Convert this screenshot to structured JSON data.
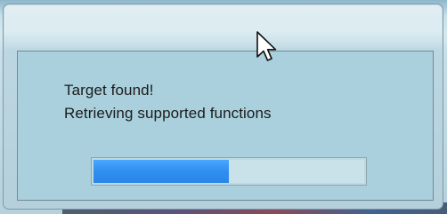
{
  "dialog": {
    "message_line_1": "Target found!",
    "message_line_2": "Retrieving supported functions",
    "progress_fraction": 0.5,
    "progress_color": "#2f8ff1"
  },
  "cursor": {
    "icon": "arrow-pointer-icon"
  }
}
